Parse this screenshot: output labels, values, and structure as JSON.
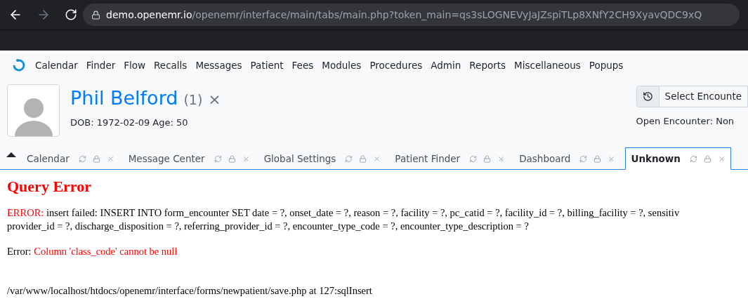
{
  "browser": {
    "url_host": "demo.openemr.io",
    "url_path": "/openemr/interface/main/tabs/main.php?token_main=qs3sLOGNEVyJaJZspiTLp8XNfY2CH9XyavQDC9xQ"
  },
  "menu": [
    "Calendar",
    "Finder",
    "Flow",
    "Recalls",
    "Messages",
    "Patient",
    "Fees",
    "Modules",
    "Procedures",
    "Admin",
    "Reports",
    "Miscellaneous",
    "Popups"
  ],
  "patient": {
    "name": "Phil Belford",
    "count": "(1)",
    "close": "×",
    "dob": "DOB: 1972-02-09 Age: 50"
  },
  "encounter": {
    "select_label": "Select Encounte",
    "open_encounter": "Open Encounter: Non"
  },
  "tabs": [
    {
      "label": "Calendar",
      "selected": false
    },
    {
      "label": "Message Center",
      "selected": false
    },
    {
      "label": "Global Settings",
      "selected": false
    },
    {
      "label": "Patient Finder",
      "selected": false
    },
    {
      "label": "Dashboard",
      "selected": false
    },
    {
      "label": "Unknown",
      "selected": true
    }
  ],
  "error": {
    "title": "Query Error",
    "prefix": "ERROR:",
    "line1": "insert failed: INSERT INTO form_encounter SET date = ?, onset_date = ?, reason = ?, facility = ?, pc_catid = ?, facility_id = ?, billing_facility = ?, sensitiv",
    "line2": "provider_id = ?, discharge_disposition = ?, referring_provider_id = ?, encounter_type_code = ?, encounter_type_description = ?",
    "error_label": "Error:",
    "error_message": "Column 'class_code' cannot be null",
    "trace": "/var/www/localhost/htdocs/openemr/interface/forms/newpatient/save.php at 127:sqlInsert"
  }
}
